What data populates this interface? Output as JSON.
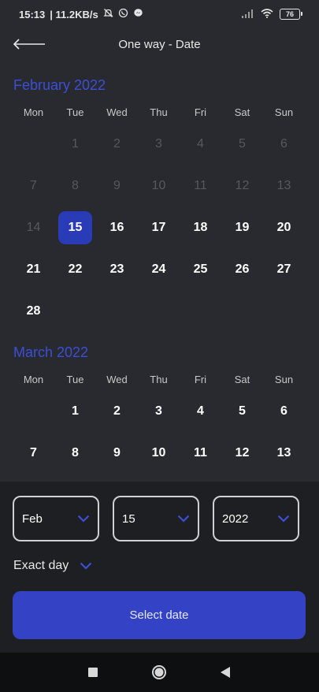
{
  "status_bar": {
    "time": "15:13",
    "speed": "| 11.2KB/s",
    "battery": "76"
  },
  "header": {
    "title": "One way - Date"
  },
  "calendar": {
    "weekdays": [
      "Mon",
      "Tue",
      "Wed",
      "Thu",
      "Fri",
      "Sat",
      "Sun"
    ],
    "months": [
      {
        "title": "February 2022",
        "weeks": [
          [
            {
              "d": ""
            },
            {
              "d": "1",
              "past": true
            },
            {
              "d": "2",
              "past": true
            },
            {
              "d": "3",
              "past": true
            },
            {
              "d": "4",
              "past": true
            },
            {
              "d": "5",
              "past": true
            },
            {
              "d": "6",
              "past": true
            }
          ],
          [
            {
              "d": "7",
              "past": true
            },
            {
              "d": "8",
              "past": true
            },
            {
              "d": "9",
              "past": true
            },
            {
              "d": "10",
              "past": true
            },
            {
              "d": "11",
              "past": true
            },
            {
              "d": "12",
              "past": true
            },
            {
              "d": "13",
              "past": true
            }
          ],
          [
            {
              "d": "14",
              "past": true
            },
            {
              "d": "15",
              "selected": true
            },
            {
              "d": "16"
            },
            {
              "d": "17"
            },
            {
              "d": "18"
            },
            {
              "d": "19"
            },
            {
              "d": "20"
            }
          ],
          [
            {
              "d": "21"
            },
            {
              "d": "22"
            },
            {
              "d": "23"
            },
            {
              "d": "24"
            },
            {
              "d": "25"
            },
            {
              "d": "26"
            },
            {
              "d": "27"
            }
          ],
          [
            {
              "d": "28"
            },
            {
              "d": ""
            },
            {
              "d": ""
            },
            {
              "d": ""
            },
            {
              "d": ""
            },
            {
              "d": ""
            },
            {
              "d": ""
            }
          ]
        ]
      },
      {
        "title": "March 2022",
        "weeks": [
          [
            {
              "d": ""
            },
            {
              "d": "1"
            },
            {
              "d": "2"
            },
            {
              "d": "3"
            },
            {
              "d": "4"
            },
            {
              "d": "5"
            },
            {
              "d": "6"
            }
          ],
          [
            {
              "d": "7"
            },
            {
              "d": "8"
            },
            {
              "d": "9"
            },
            {
              "d": "10"
            },
            {
              "d": "11"
            },
            {
              "d": "12"
            },
            {
              "d": "13"
            }
          ]
        ]
      }
    ]
  },
  "selectors": {
    "month": "Feb",
    "day": "15",
    "year": "2022"
  },
  "flex": {
    "label": "Exact day"
  },
  "action": {
    "select_label": "Select date"
  },
  "colors": {
    "accent": "#3443c6",
    "selected_day": "#2a3bb8",
    "month_title": "#3b4fd6"
  }
}
